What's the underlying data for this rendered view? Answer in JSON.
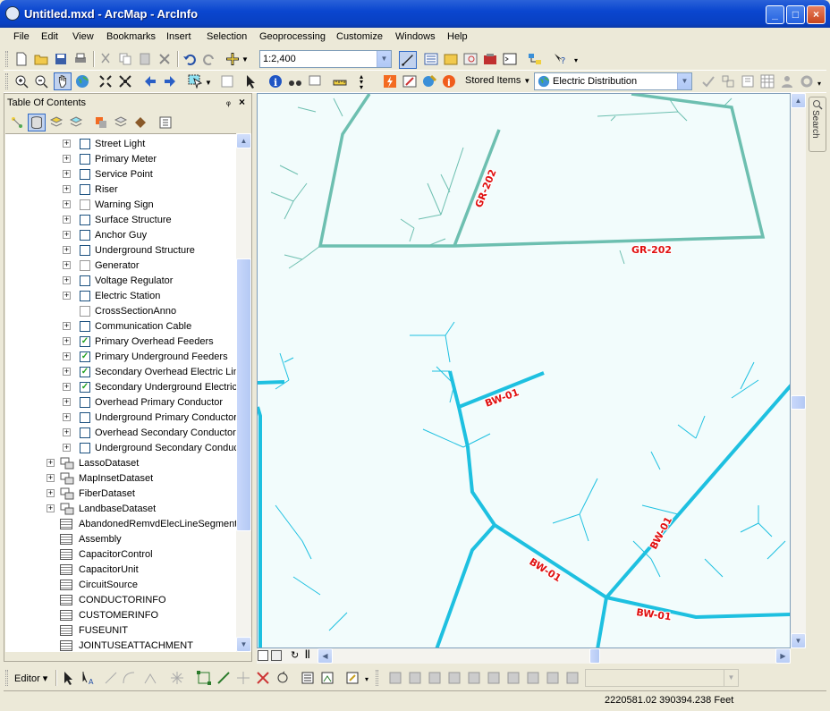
{
  "window": {
    "title": "Untitled.mxd - ArcMap - ArcInfo"
  },
  "menu": [
    "File",
    "Edit",
    "View",
    "Bookmarks",
    "Insert",
    "Selection",
    "Geoprocessing",
    "Customize",
    "Windows",
    "Help"
  ],
  "toolbar": {
    "scale": "1:2,400",
    "stored_items": "Stored Items",
    "workspace": "Electric Distribution"
  },
  "toc": {
    "title": "Table Of Contents",
    "layers": [
      {
        "label": "Street Light",
        "checked": false
      },
      {
        "label": "Primary Meter",
        "checked": false
      },
      {
        "label": "Service Point",
        "checked": false
      },
      {
        "label": "Riser",
        "checked": false
      },
      {
        "label": "Warning Sign",
        "checked": false
      },
      {
        "label": "Surface Structure",
        "checked": false
      },
      {
        "label": "Anchor Guy",
        "checked": false
      },
      {
        "label": "Underground Structure",
        "checked": false
      },
      {
        "label": "Generator",
        "checked": false
      },
      {
        "label": "Voltage Regulator",
        "checked": false
      },
      {
        "label": "Electric Station",
        "checked": false
      },
      {
        "label": "CrossSectionAnno",
        "checked": false
      },
      {
        "label": "Communication Cable",
        "checked": false
      },
      {
        "label": "Primary Overhead Feeders",
        "checked": true
      },
      {
        "label": "Primary Underground Feeders",
        "checked": true
      },
      {
        "label": "Secondary Overhead Electric Lin",
        "checked": true
      },
      {
        "label": "Secondary Underground Electric",
        "checked": true
      },
      {
        "label": "Overhead Primary Conductor",
        "checked": false
      },
      {
        "label": "Underground Primary Conductor",
        "checked": false
      },
      {
        "label": "Overhead Secondary Conductor",
        "checked": false
      },
      {
        "label": "Underground Secondary Conduc",
        "checked": false
      }
    ],
    "datasets": [
      "LassoDataset",
      "MapInsetDataset",
      "FiberDataset",
      "LandbaseDataset"
    ],
    "tables": [
      "AbandonedRemvdElecLineSegment",
      "Assembly",
      "CapacitorControl",
      "CapacitorUnit",
      "CircuitSource",
      "CONDUCTORINFO",
      "CUSTOMERINFO",
      "FUSEUNIT",
      "JOINTUSEATTACHMENT"
    ]
  },
  "map": {
    "labels": [
      "GR-202",
      "GR-202",
      "BW-01",
      "BW-01",
      "BW-01",
      "BW-01"
    ],
    "colors": {
      "green_feeder": "#6dbfb0",
      "cyan_feeder": "#1ec0e0",
      "label": "#e01010",
      "background": "#f2fcfc"
    }
  },
  "search_tab": "Search",
  "editor": {
    "label": "Editor ▾"
  },
  "status": {
    "coordinates": "2220581.02  390394.238 Feet"
  }
}
